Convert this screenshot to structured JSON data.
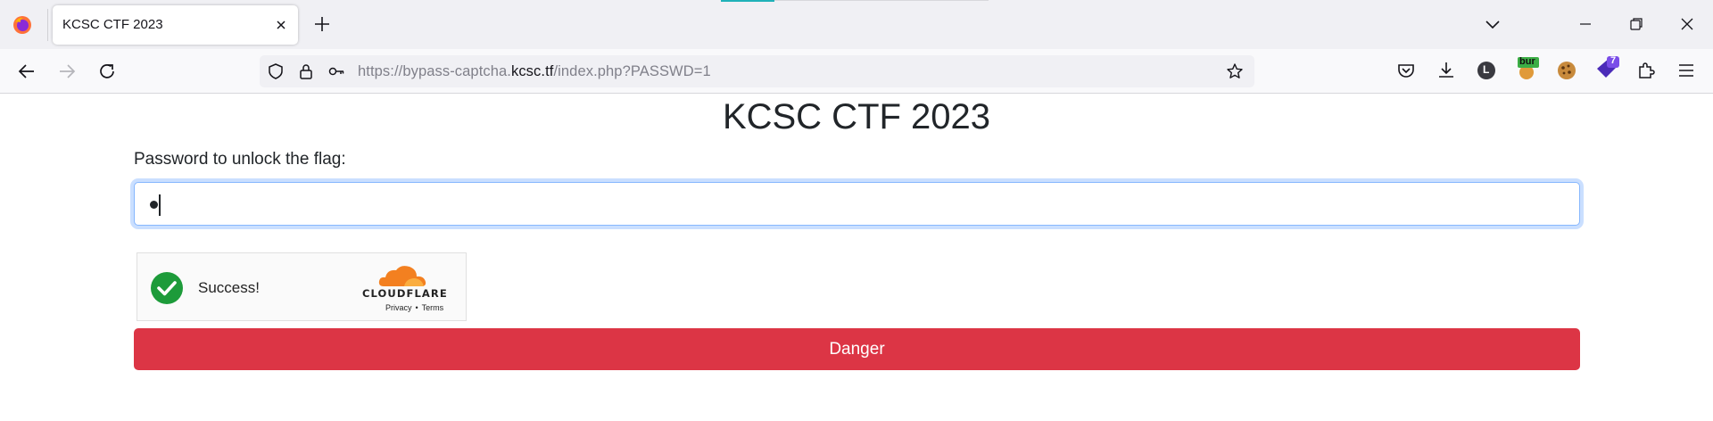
{
  "browser": {
    "tab": {
      "title": "KCSC CTF 2023"
    },
    "url": {
      "prefix": "https://bypass-captcha.",
      "host": "kcsc.tf",
      "path": "/index.php?PASSWD=1"
    },
    "toolbar_icons": [
      "pocket-icon",
      "download-icon",
      "account-l-icon",
      "burp-extension-icon",
      "cookie-extension-icon",
      "extension-badge-icon",
      "extensions-icon",
      "menu-icon"
    ],
    "extensions": {
      "burp_badge": "bur",
      "account_letter": "L",
      "notification_count": "7"
    }
  },
  "page": {
    "title": "KCSC CTF 2023",
    "password_label": "Password to unlock the flag:",
    "password_value": "•",
    "captcha": {
      "status": "Success!",
      "brand": "CLOUDFLARE",
      "privacy": "Privacy",
      "separator": "•",
      "terms": "Terms"
    },
    "submit_label": "Danger"
  },
  "colors": {
    "danger": "#dc3545",
    "success_green": "#1d9b3a",
    "cloudflare_orange": "#f38020",
    "input_focus": "#86b7fe"
  }
}
